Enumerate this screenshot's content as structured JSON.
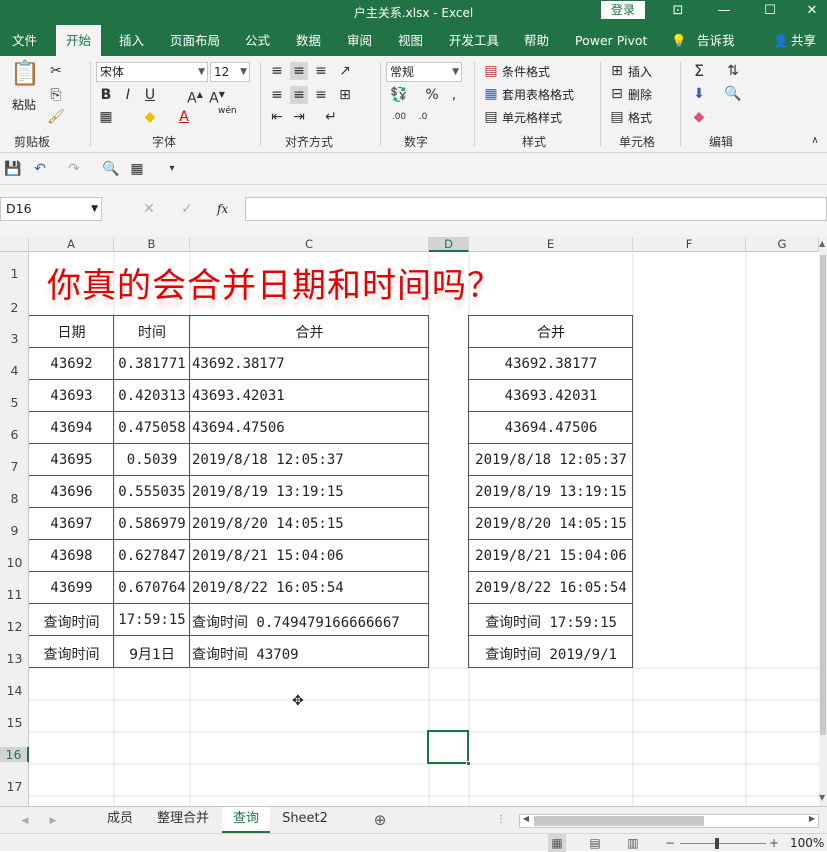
{
  "window": {
    "title": "户主关系.xlsx  -  Excel",
    "login_label": "登录"
  },
  "menu": {
    "file": "文件",
    "home": "开始",
    "insert": "插入",
    "page_layout": "页面布局",
    "formulas": "公式",
    "data": "数据",
    "review": "审阅",
    "view": "视图",
    "developer": "开发工具",
    "help": "帮助",
    "power_pivot": "Power Pivot",
    "tell_me": "告诉我",
    "share": "共享"
  },
  "ribbon": {
    "clipboard": {
      "label": "剪贴板",
      "paste": "粘贴"
    },
    "font": {
      "label": "字体",
      "name": "宋体",
      "size": "12",
      "wen": "wén"
    },
    "alignment": {
      "label": "对齐方式"
    },
    "number": {
      "label": "数字",
      "format": "常规"
    },
    "styles": {
      "label": "样式",
      "cond_format": "条件格式",
      "table_format": "套用表格格式",
      "cell_styles": "单元格样式"
    },
    "cells": {
      "label": "单元格",
      "insert": "插入",
      "delete": "删除",
      "format": "格式"
    },
    "editing": {
      "label": "编辑"
    }
  },
  "formula_bar": {
    "name_box": "D16",
    "fx": "fx",
    "value": ""
  },
  "columns": [
    "A",
    "B",
    "C",
    "D",
    "E",
    "F",
    "G"
  ],
  "rows": [
    "1",
    "2",
    "3",
    "4",
    "5",
    "6",
    "7",
    "8",
    "9",
    "10",
    "11",
    "12",
    "13",
    "14",
    "15",
    "16",
    "17"
  ],
  "sheet": {
    "title": "你真的会合并日期和时间吗？",
    "header_date": "日期",
    "header_time": "时间",
    "header_merge": "合并",
    "header_merge2": "合并",
    "dates": [
      "43692",
      "43693",
      "43694",
      "43695",
      "43696",
      "43697",
      "43698",
      "43699",
      "查询时间",
      "查询时间"
    ],
    "times": [
      "0.381771",
      "0.420313",
      "0.475058",
      "0.5039",
      "0.555035",
      "0.586979",
      "0.627847",
      "0.670764",
      "17:59:15",
      "9月1日"
    ],
    "merged": [
      "43692.38177",
      "43693.42031",
      "43694.47506",
      "2019/8/18 12:05:37",
      "2019/8/19 13:19:15",
      "2019/8/20 14:05:15",
      "2019/8/21 15:04:06",
      "2019/8/22 16:05:54",
      "查询时间 0.749479166666667",
      "查询时间 43709"
    ],
    "merged2": [
      "43692.38177",
      "43693.42031",
      "43694.47506",
      "2019/8/18 12:05:37",
      "2019/8/19 13:19:15",
      "2019/8/20 14:05:15",
      "2019/8/21 15:04:06",
      "2019/8/22 16:05:54",
      "查询时间 17:59:15",
      "查询时间 2019/9/1"
    ]
  },
  "sheet_tabs": [
    "成员",
    "整理合并",
    "查询",
    "Sheet2"
  ],
  "active_tab": "查询",
  "status": {
    "zoom": "100%"
  },
  "colors": {
    "excel_green": "#217346",
    "title_red": "#e60000"
  }
}
